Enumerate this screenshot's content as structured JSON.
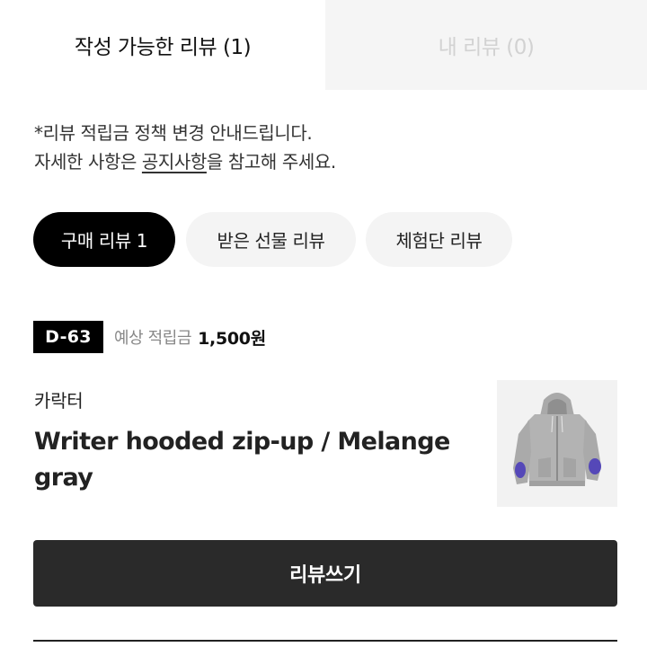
{
  "tabs": [
    {
      "label": "작성 가능한 리뷰 (1)",
      "active": true
    },
    {
      "label": "내 리뷰 (0)",
      "active": false
    }
  ],
  "notice": {
    "line1": "*리뷰 적립금 정책 변경 안내드립니다.",
    "line2_prefix": "자세한 사항은 ",
    "line2_link": "공지사항",
    "line2_suffix": "을 참고해 주세요."
  },
  "filters": [
    {
      "label": "구매 리뷰 1",
      "selected": true
    },
    {
      "label": "받은 선물 리뷰",
      "selected": false
    },
    {
      "label": "체험단 리뷰",
      "selected": false
    }
  ],
  "item": {
    "dday": "D-63",
    "reward_label": "예상 적립금",
    "reward_amount": "1,500원",
    "brand": "카락터",
    "name": "Writer hooded zip-up / Melange gray",
    "thumbnail_icon": "gray-hoodie-image"
  },
  "actions": {
    "write_review": "리뷰쓰기"
  },
  "colors": {
    "primary": "#000000",
    "button": "#2a2a2a",
    "chip_bg": "#f4f4f4",
    "inactive_tab_bg": "#f5f5f5",
    "inactive_tab_text": "#d2d2d2",
    "muted_text": "#888888"
  }
}
